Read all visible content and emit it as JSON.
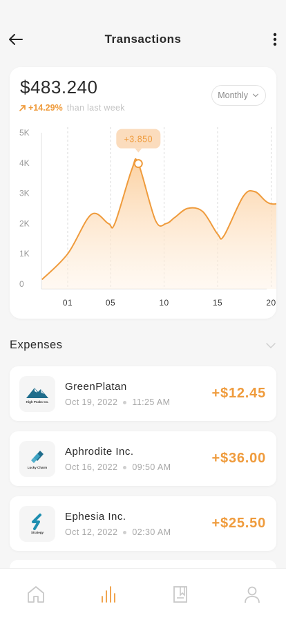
{
  "header": {
    "title": "Transactions",
    "back_icon": "arrow-left-icon",
    "more_icon": "more-vertical-icon"
  },
  "summary": {
    "balance": "$483.240",
    "change": "+14.29%",
    "change_note": "than last week",
    "change_icon": "arrow-up-right-icon",
    "period": "Monthly"
  },
  "colors": {
    "accent": "#ef9b3c",
    "accent_light": "#fbd7b0",
    "background": "#f6f6f6"
  },
  "chart_data": {
    "type": "area",
    "x_ticks": [
      "01",
      "05",
      "10",
      "15",
      "20"
    ],
    "y_ticks": [
      "5K",
      "4K",
      "3K",
      "2K",
      "1K",
      "0"
    ],
    "ylim": [
      0,
      5000
    ],
    "x": [
      -1.4,
      1,
      3.2,
      4.8,
      5.4,
      7,
      7.6,
      9.2,
      10.2,
      11,
      12.2,
      13.6,
      15,
      15.6,
      17.4,
      18.5,
      20,
      22.5
    ],
    "values": [
      150,
      1000,
      2300,
      2000,
      2000,
      3800,
      3980,
      2100,
      2000,
      2200,
      2500,
      2400,
      1650,
      1600,
      2900,
      3050,
      2650,
      2800
    ],
    "highlight": {
      "x": 7.6,
      "y": 3980,
      "label": "+3.850"
    }
  },
  "expenses": {
    "title": "Expenses",
    "toggle_icon": "chevron-down-icon",
    "items": [
      {
        "name": "GreenPlatan",
        "date": "Oct 19, 2022",
        "time": "11:25 AM",
        "amount": "+$12.45",
        "logo_text": "High Peaks Co.",
        "logo_icon": "mountain-logo-icon"
      },
      {
        "name": "Aphrodite Inc.",
        "date": "Oct 16, 2022",
        "time": "09:50 AM",
        "amount": "+$36.00",
        "logo_text": "Lucky Charm",
        "logo_icon": "diamond-logo-icon"
      },
      {
        "name": "Ephesia Inc.",
        "date": "Oct 12, 2022",
        "time": "02:30 AM",
        "amount": "+$25.50",
        "logo_text": "Strategy",
        "logo_icon": "s-logo-icon"
      }
    ]
  },
  "nav": {
    "items": [
      {
        "icon": "home-icon",
        "active": false
      },
      {
        "icon": "bar-chart-icon",
        "active": true
      },
      {
        "icon": "receipt-icon",
        "active": false
      },
      {
        "icon": "user-icon",
        "active": false
      }
    ]
  }
}
